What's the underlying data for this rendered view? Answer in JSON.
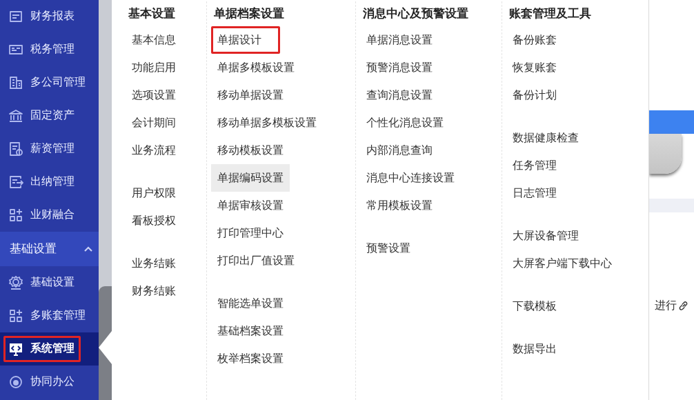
{
  "sidebar": {
    "items": [
      {
        "label": "财务报表",
        "kind": "item",
        "selected": false,
        "annotated": false
      },
      {
        "label": "税务管理",
        "kind": "item",
        "selected": false,
        "annotated": false
      },
      {
        "label": "多公司管理",
        "kind": "item",
        "selected": false,
        "annotated": false
      },
      {
        "label": "固定资产",
        "kind": "item",
        "selected": false,
        "annotated": false
      },
      {
        "label": "薪资管理",
        "kind": "item",
        "selected": false,
        "annotated": false
      },
      {
        "label": "出纳管理",
        "kind": "item",
        "selected": false,
        "annotated": false
      },
      {
        "label": "业财融合",
        "kind": "item",
        "selected": false,
        "annotated": false
      },
      {
        "label": "基础设置",
        "kind": "section",
        "expanded": true
      },
      {
        "label": "基础设置",
        "kind": "item",
        "selected": false,
        "annotated": false
      },
      {
        "label": "多账套管理",
        "kind": "item",
        "selected": false,
        "annotated": false
      },
      {
        "label": "系统管理",
        "kind": "item",
        "selected": true,
        "annotated": true
      },
      {
        "label": "协同办公",
        "kind": "item",
        "selected": false,
        "annotated": false
      }
    ]
  },
  "menu": {
    "columns": [
      {
        "title": "基本设置",
        "groups": [
          {
            "items": [
              {
                "label": "基本信息",
                "hovered": false,
                "annotated": false
              },
              {
                "label": "功能启用",
                "hovered": false,
                "annotated": false
              },
              {
                "label": "选项设置",
                "hovered": false,
                "annotated": false
              },
              {
                "label": "会计期间",
                "hovered": false,
                "annotated": false
              },
              {
                "label": "业务流程",
                "hovered": false,
                "annotated": false
              }
            ]
          },
          {
            "items": [
              {
                "label": "用户权限",
                "hovered": false,
                "annotated": false
              },
              {
                "label": "看板授权",
                "hovered": false,
                "annotated": false
              }
            ]
          },
          {
            "items": [
              {
                "label": "业务结账",
                "hovered": false,
                "annotated": false
              },
              {
                "label": "财务结账",
                "hovered": false,
                "annotated": false
              }
            ]
          }
        ]
      },
      {
        "title": "单据档案设置",
        "groups": [
          {
            "items": [
              {
                "label": "单据设计",
                "hovered": false,
                "annotated": true
              },
              {
                "label": "单据多模板设置",
                "hovered": false,
                "annotated": false
              },
              {
                "label": "移动单据设置",
                "hovered": false,
                "annotated": false
              },
              {
                "label": "移动单据多模板设置",
                "hovered": false,
                "annotated": false
              },
              {
                "label": "移动模板设置",
                "hovered": false,
                "annotated": false
              },
              {
                "label": "单据编码设置",
                "hovered": true,
                "annotated": false
              },
              {
                "label": "单据审核设置",
                "hovered": false,
                "annotated": false
              },
              {
                "label": "打印管理中心",
                "hovered": false,
                "annotated": false
              },
              {
                "label": "打印出厂值设置",
                "hovered": false,
                "annotated": false
              }
            ]
          },
          {
            "items": [
              {
                "label": "智能选单设置",
                "hovered": false,
                "annotated": false
              },
              {
                "label": "基础档案设置",
                "hovered": false,
                "annotated": false
              },
              {
                "label": "枚举档案设置",
                "hovered": false,
                "annotated": false
              }
            ]
          }
        ]
      },
      {
        "title": "消息中心及预警设置",
        "groups": [
          {
            "items": [
              {
                "label": "单据消息设置",
                "hovered": false,
                "annotated": false
              },
              {
                "label": "预警消息设置",
                "hovered": false,
                "annotated": false
              },
              {
                "label": "查询消息设置",
                "hovered": false,
                "annotated": false
              },
              {
                "label": "个性化消息设置",
                "hovered": false,
                "annotated": false
              },
              {
                "label": "内部消息查询",
                "hovered": false,
                "annotated": false
              },
              {
                "label": "消息中心连接设置",
                "hovered": false,
                "annotated": false
              },
              {
                "label": "常用模板设置",
                "hovered": false,
                "annotated": false
              }
            ]
          },
          {
            "items": [
              {
                "label": "预警设置",
                "hovered": false,
                "annotated": false
              }
            ]
          }
        ]
      },
      {
        "title": "账套管理及工具",
        "groups": [
          {
            "items": [
              {
                "label": "备份账套",
                "hovered": false,
                "annotated": false
              },
              {
                "label": "恢复账套",
                "hovered": false,
                "annotated": false
              },
              {
                "label": "备份计划",
                "hovered": false,
                "annotated": false
              }
            ]
          },
          {
            "items": [
              {
                "label": "数据健康检查",
                "hovered": false,
                "annotated": false
              },
              {
                "label": "任务管理",
                "hovered": false,
                "annotated": false
              },
              {
                "label": "日志管理",
                "hovered": false,
                "annotated": false
              }
            ]
          },
          {
            "items": [
              {
                "label": "大屏设备管理",
                "hovered": false,
                "annotated": false
              },
              {
                "label": "大屏客户端下载中心",
                "hovered": false,
                "annotated": false
              }
            ]
          },
          {
            "items": [
              {
                "label": "下载模板",
                "hovered": false,
                "annotated": false
              }
            ]
          },
          {
            "items": [
              {
                "label": "数据导出",
                "hovered": false,
                "annotated": false
              }
            ]
          }
        ]
      }
    ]
  },
  "background_page": {
    "text": "进行"
  }
}
